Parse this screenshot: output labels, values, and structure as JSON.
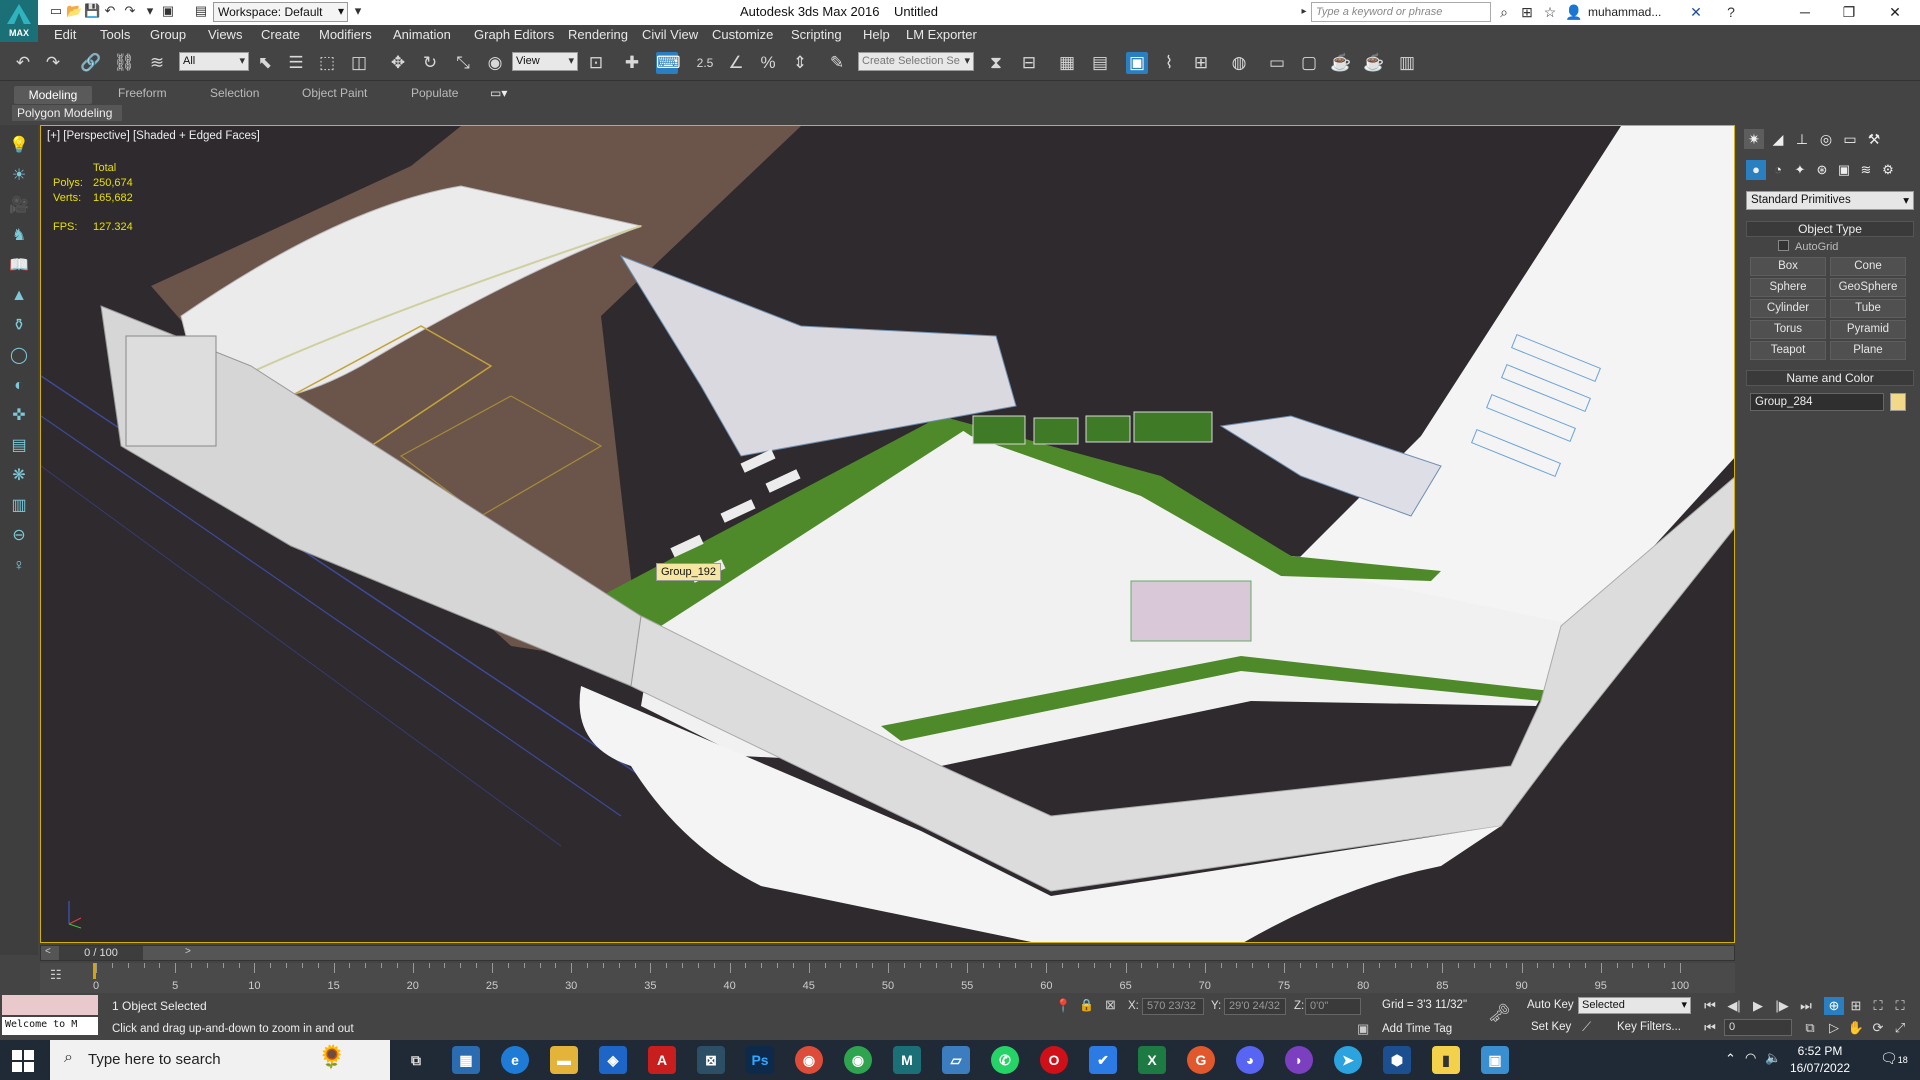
{
  "titlebar": {
    "logo_text": "MAX",
    "workspace": "Workspace: Default",
    "app_title": "Autodesk 3ds Max 2016",
    "doc_title": "Untitled",
    "search_placeholder": "Type a keyword or phrase",
    "user": "muhammad..."
  },
  "menu": [
    "Edit",
    "Tools",
    "Group",
    "Views",
    "Create",
    "Modifiers",
    "Animation",
    "Graph Editors",
    "Rendering",
    "Civil View",
    "Customize",
    "Scripting",
    "Help",
    "LM Exporter"
  ],
  "toolbar": {
    "filter_value": "All",
    "refcoord_value": "View",
    "snap_label": "2.5",
    "selection_set_placeholder": "Create Selection Se"
  },
  "ribbon": {
    "tabs": [
      "Modeling",
      "Freeform",
      "Selection",
      "Object Paint",
      "Populate"
    ],
    "panel_label": "Polygon Modeling"
  },
  "viewport": {
    "label": "[+] [Perspective] [Shaded + Edged Faces]",
    "stats_header": "Total",
    "polys_label": "Polys:",
    "polys_value": "250,674",
    "verts_label": "Verts:",
    "verts_value": "165,682",
    "fps_label": "FPS:",
    "fps_value": "127.324",
    "tooltip": "Group_192"
  },
  "command_panel": {
    "category": "Standard Primitives",
    "object_type_title": "Object Type",
    "autogrid_label": "AutoGrid",
    "buttons": [
      "Box",
      "Cone",
      "Sphere",
      "GeoSphere",
      "Cylinder",
      "Tube",
      "Torus",
      "Pyramid",
      "Teapot",
      "Plane"
    ],
    "name_color_title": "Name and Color",
    "object_name": "Group_284",
    "object_color": "#f2d98a"
  },
  "timeline": {
    "frame_display": "0 / 100",
    "ticks": [
      "0",
      "5",
      "10",
      "15",
      "20",
      "25",
      "30",
      "35",
      "40",
      "45",
      "50",
      "55",
      "60",
      "65",
      "70",
      "75",
      "80",
      "85",
      "90",
      "95",
      "100"
    ]
  },
  "status": {
    "listener_text": "Welcome to M",
    "selected_text": "1 Object Selected",
    "prompt_text": "Click and drag up-and-down to zoom in and out",
    "x_label": "X:",
    "x_value": "570 23/32",
    "y_label": "Y:",
    "y_value": "29'0 24/32",
    "z_label": "Z:",
    "z_value": "0'0\"",
    "grid_text": "Grid = 3'3 11/32\"",
    "add_time_tag": "Add Time Tag",
    "auto_key": "Auto Key",
    "set_key": "Set Key",
    "key_mode_value": "Selected",
    "key_filters": "Key Filters...",
    "current_frame": "0"
  },
  "taskbar": {
    "search_placeholder": "Type here to search",
    "time": "6:52 PM",
    "date": "16/07/2022",
    "notif_count": "18"
  },
  "colors": {
    "accent": "#2a7fc0",
    "viewport_border": "#d4b000",
    "stats_text": "#e7e000",
    "grass": "#4f8a2a"
  }
}
